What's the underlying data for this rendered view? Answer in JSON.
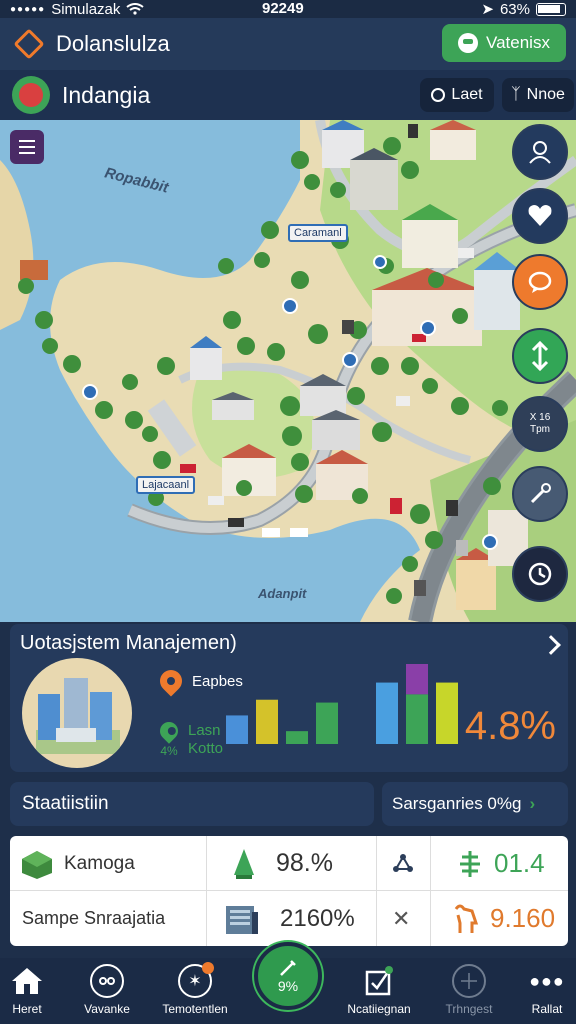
{
  "status": {
    "carrier": "Simulazak",
    "time": "92249",
    "battery": "63%"
  },
  "header": {
    "title": "Dolanslulza",
    "action_label": "Vatenisx"
  },
  "region": {
    "title": "Indangia",
    "last_label": "Laet",
    "none_label": "Nnoe"
  },
  "map": {
    "water_labels": [
      "Ropabbit",
      "Adanpit"
    ],
    "place_labels": [
      "Caramanl",
      "Lajacaanl"
    ]
  },
  "side_buttons": {
    "info_line1": "X 16",
    "info_line2": "Tpm"
  },
  "management": {
    "title": "Uotasjstem Manajemen)",
    "legend1": "Eapbes",
    "legend2a": "Lasn",
    "legend2b": "Kotto",
    "legend2_pct": "4%",
    "percent": "4.8%",
    "bars": [
      {
        "value": 0.2,
        "color": "#4a90d9"
      },
      {
        "value": 0.31,
        "color": "#d4c22a"
      },
      {
        "value": 0.09,
        "color": "#3da457"
      },
      {
        "value": 0.29,
        "color": "#3da457"
      },
      {
        "value": 0.43,
        "color": "#4a9fe0"
      },
      {
        "value": 0.56,
        "color": "#8a3fa8",
        "color2": "#3da457"
      },
      {
        "value": 0.43,
        "color": "#c7d62a"
      }
    ]
  },
  "stats": {
    "left_title": "Staatiistiin",
    "right_title": "Sarsganries 0%g",
    "rows": [
      {
        "label": "Kamoga",
        "value1": "98.%",
        "value2": "01.4"
      },
      {
        "label": "Sampe Snraajatia",
        "value1": "2160%",
        "value2": "9.160"
      }
    ]
  },
  "nav": {
    "items": [
      "Heret",
      "Vavanke",
      "Temotentlen",
      "Ncatiiegnan",
      "Trhngest",
      "Rallat"
    ],
    "center": "9%"
  }
}
